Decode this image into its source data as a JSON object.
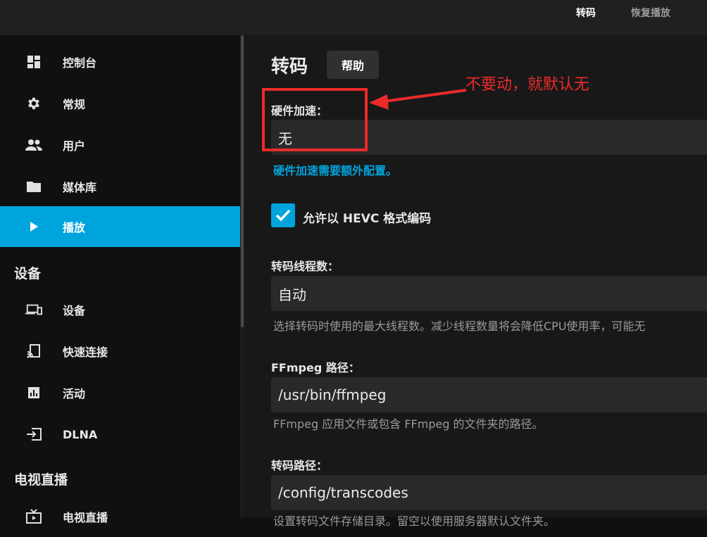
{
  "header": {
    "tabs": [
      {
        "label": "转码",
        "active": true
      },
      {
        "label": "恢复播放",
        "active": false
      }
    ]
  },
  "sidebar": {
    "items": [
      {
        "label": "控制台",
        "icon": "dashboard-icon"
      },
      {
        "label": "常规",
        "icon": "gear-icon"
      },
      {
        "label": "用户",
        "icon": "users-icon"
      },
      {
        "label": "媒体库",
        "icon": "folder-icon"
      },
      {
        "label": "播放",
        "icon": "play-icon",
        "active": true
      }
    ],
    "sections": [
      {
        "title": "设备",
        "items": [
          {
            "label": "设备",
            "icon": "devices-icon"
          },
          {
            "label": "快速连接",
            "icon": "cast-icon"
          },
          {
            "label": "活动",
            "icon": "chart-icon"
          },
          {
            "label": "DLNA",
            "icon": "input-icon"
          }
        ]
      },
      {
        "title": "电视直播",
        "items": [
          {
            "label": "电视直播",
            "icon": "tv-icon"
          }
        ]
      }
    ]
  },
  "main": {
    "title": "转码",
    "help_label": "帮助",
    "hw_accel": {
      "label": "硬件加速：",
      "value": "无",
      "link": "硬件加速需要额外配置。"
    },
    "hevc": {
      "label": "允许以 HEVC 格式编码",
      "checked": true
    },
    "threads": {
      "label": "转码线程数：",
      "value": "自动",
      "description": "选择转码时使用的最大线程数。减少线程数量将会降低CPU使用率，可能无"
    },
    "ffmpeg": {
      "label": "FFmpeg 路径：",
      "value": "/usr/bin/ffmpeg",
      "description": "FFmpeg 应用文件或包含 FFmpeg 的文件夹的路径。"
    },
    "transcode_path": {
      "label": "转码路径：",
      "value": "/config/transcodes",
      "description": "设置转码文件存储目录。留空以使用服务器默认文件夹。"
    }
  },
  "annotation": {
    "text": "不要动，就默认无",
    "color": "#ec2a2a"
  },
  "colors": {
    "accent": "#00a4dc",
    "background": "#101010",
    "panel": "#181818",
    "input": "#292929"
  }
}
